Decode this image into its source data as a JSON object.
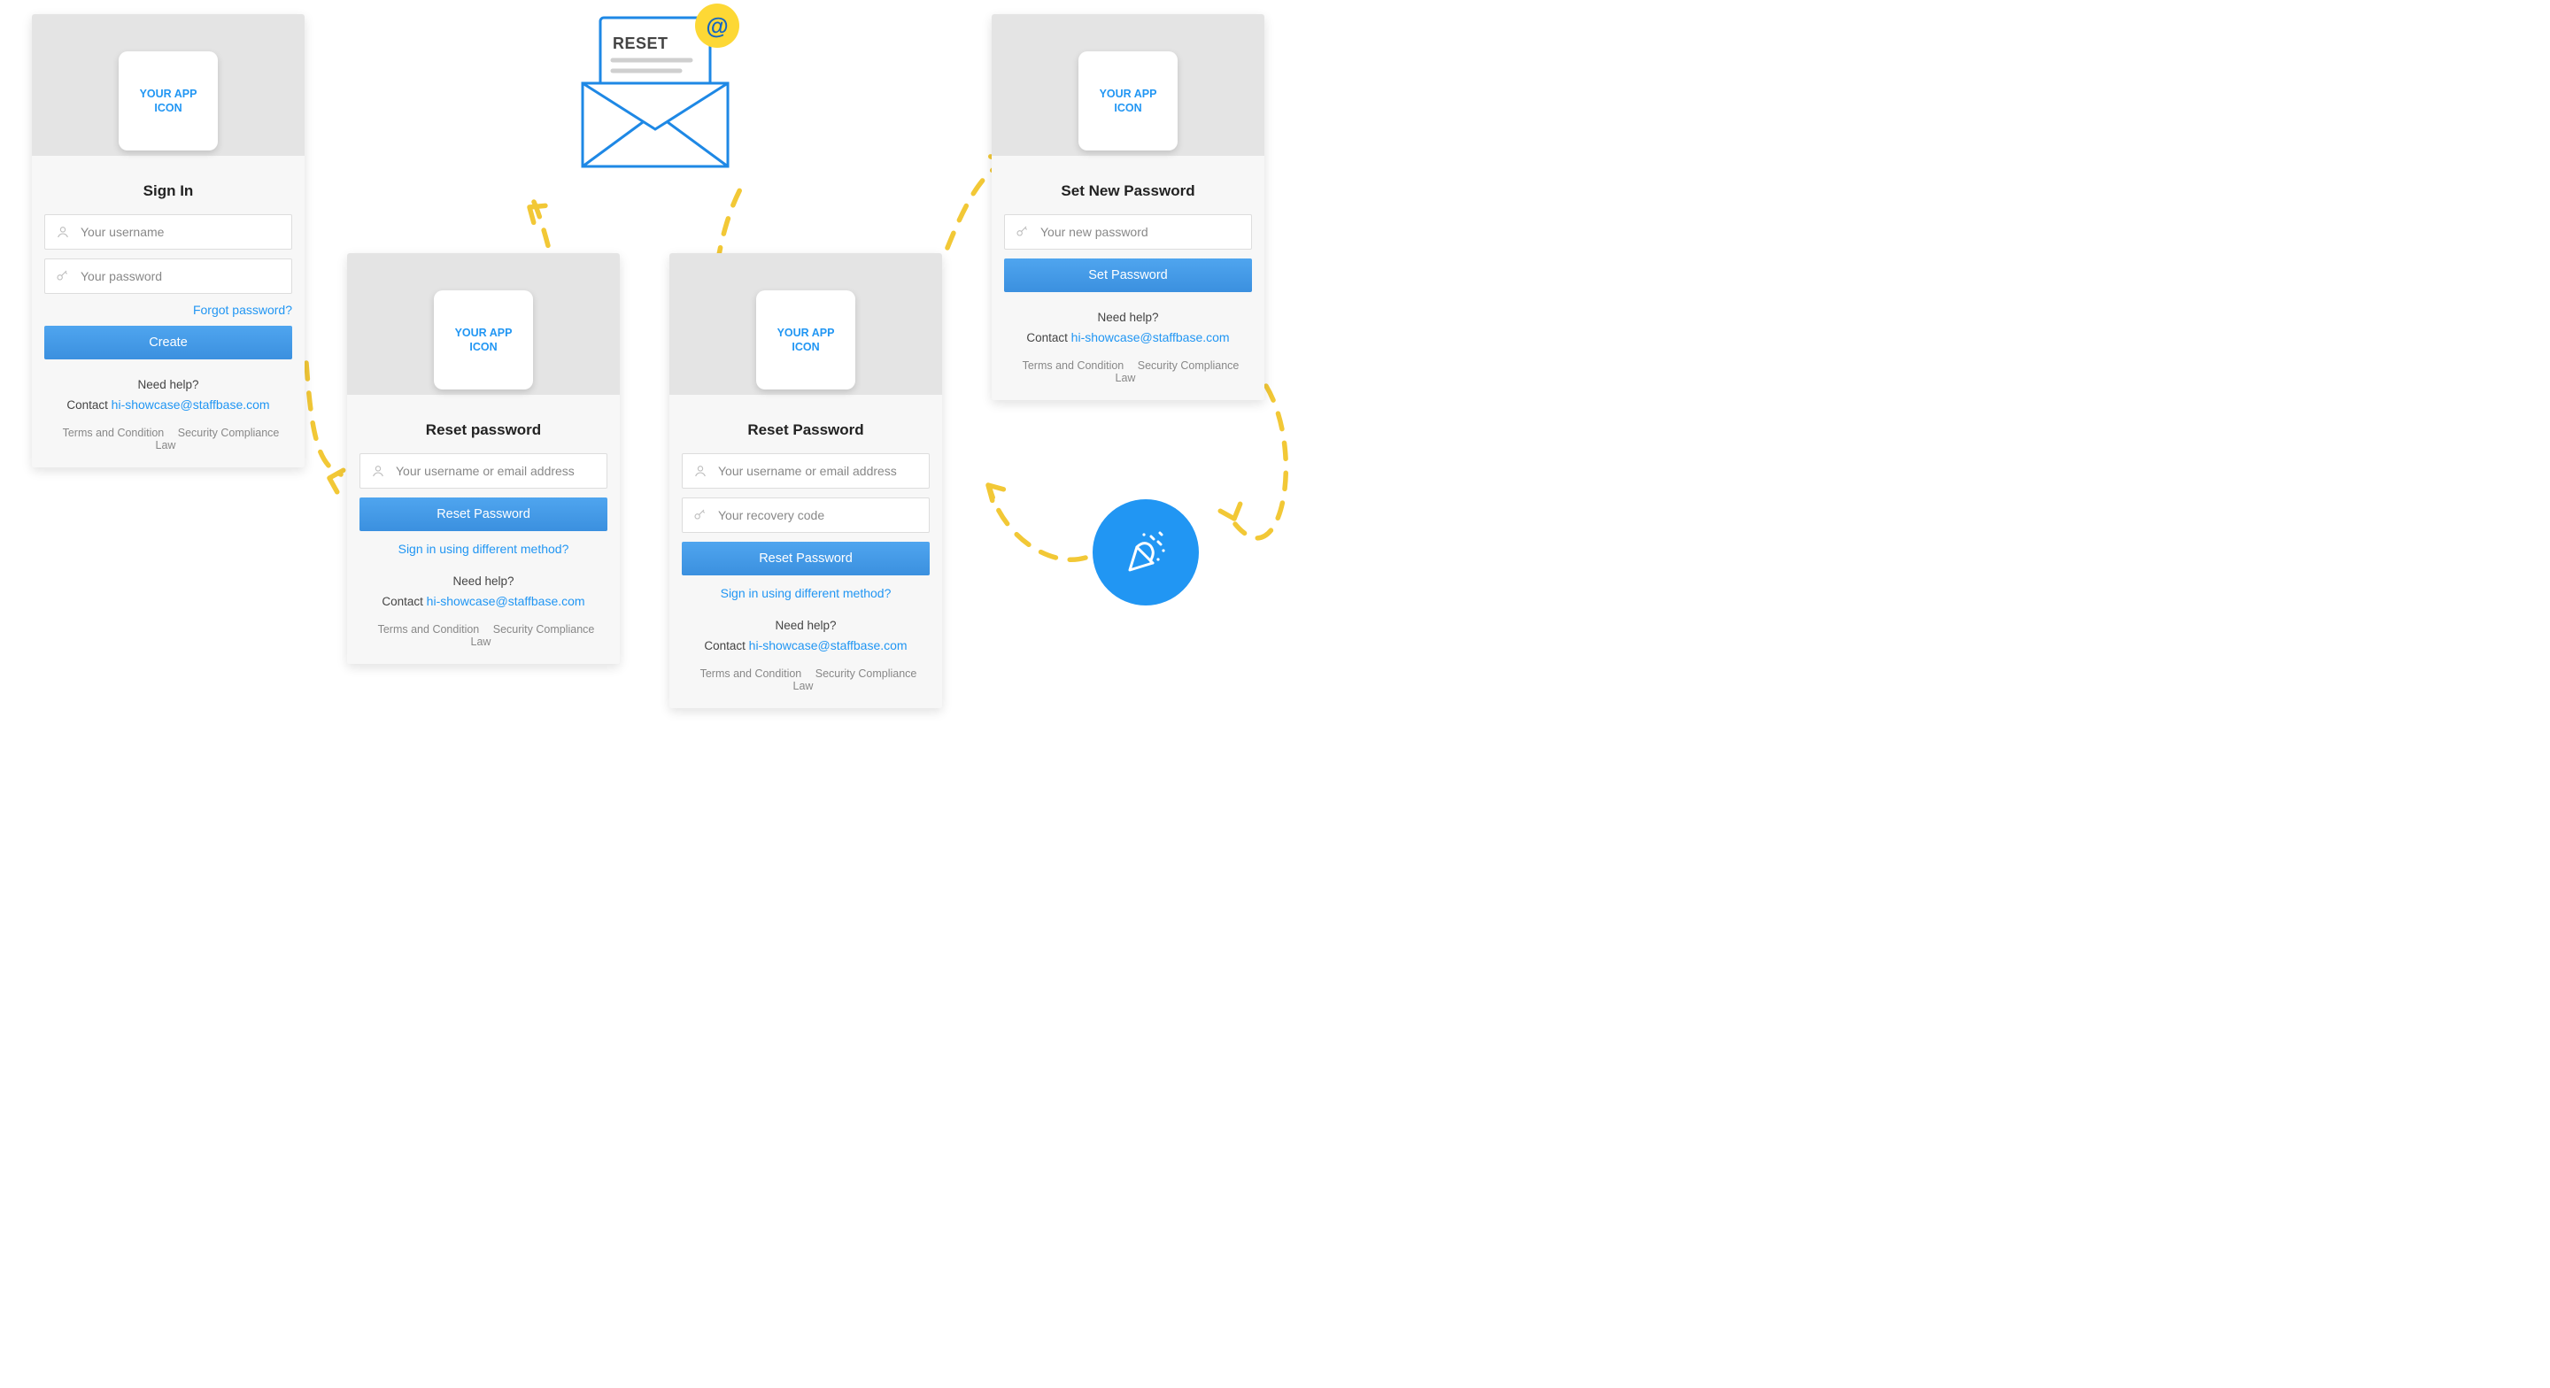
{
  "appIconText": "YOUR APP ICON",
  "envelope": {
    "label": "RESET",
    "at": "@"
  },
  "helpBlock": {
    "line1": "Need help?",
    "line2prefix": "Contact ",
    "email": "hi-showcase@staffbase.com"
  },
  "footer": {
    "terms": "Terms and Condition",
    "compliance": "Security Compliance Law"
  },
  "card1": {
    "title": "Sign In",
    "usernamePH": "Your username",
    "passwordPH": "Your password",
    "forgot": "Forgot password?",
    "button": "Create"
  },
  "card2": {
    "title": "Reset password",
    "idPH": "Your username or email address",
    "button": "Reset Password",
    "altLink": "Sign in using different method?"
  },
  "card3": {
    "title": "Reset Password",
    "idPH": "Your username or email address",
    "codePH": "Your recovery code",
    "button": "Reset Password",
    "altLink": "Sign in using different method?"
  },
  "card4": {
    "title": "Set New Password",
    "newPwPH": "Your new password",
    "button": "Set Password"
  }
}
